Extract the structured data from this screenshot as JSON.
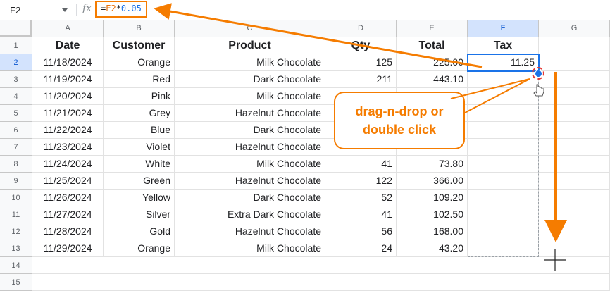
{
  "formula_bar": {
    "name_box": "F2",
    "fx_label": "fx",
    "formula": {
      "eq": "=",
      "ref": "E2",
      "op": "*",
      "num": "0.05"
    }
  },
  "columns": [
    "A",
    "B",
    "C",
    "D",
    "E",
    "F",
    "G"
  ],
  "row_numbers": [
    "1",
    "2",
    "3",
    "4",
    "5",
    "6",
    "7",
    "8",
    "9",
    "10",
    "11",
    "12",
    "13",
    "14",
    "15"
  ],
  "headers": {
    "date": "Date",
    "customer": "Customer",
    "product": "Product",
    "qty": "Qty",
    "total": "Total",
    "tax": "Tax"
  },
  "rows": [
    {
      "date": "11/18/2024",
      "customer": "Orange",
      "product": "Milk Chocolate",
      "qty": "125",
      "total": "225.00",
      "tax": "11.25"
    },
    {
      "date": "11/19/2024",
      "customer": "Red",
      "product": "Dark Chocolate",
      "qty": "211",
      "total": "443.10",
      "tax": ""
    },
    {
      "date": "11/20/2024",
      "customer": "Pink",
      "product": "Milk Chocolate",
      "qty": "",
      "total": "",
      "tax": ""
    },
    {
      "date": "11/21/2024",
      "customer": "Grey",
      "product": "Hazelnut Chocolate",
      "qty": "",
      "total": "",
      "tax": ""
    },
    {
      "date": "11/22/2024",
      "customer": "Blue",
      "product": "Dark Chocolate",
      "qty": "",
      "total": "",
      "tax": ""
    },
    {
      "date": "11/23/2024",
      "customer": "Violet",
      "product": "Hazelnut Chocolate",
      "qty": "",
      "total": "",
      "tax": ""
    },
    {
      "date": "11/24/2024",
      "customer": "White",
      "product": "Milk Chocolate",
      "qty": "41",
      "total": "73.80",
      "tax": ""
    },
    {
      "date": "11/25/2024",
      "customer": "Green",
      "product": "Hazelnut Chocolate",
      "qty": "122",
      "total": "366.00",
      "tax": ""
    },
    {
      "date": "11/26/2024",
      "customer": "Yellow",
      "product": "Dark Chocolate",
      "qty": "52",
      "total": "109.20",
      "tax": ""
    },
    {
      "date": "11/27/2024",
      "customer": "Silver",
      "product": "Extra Dark Chocolate",
      "qty": "41",
      "total": "102.50",
      "tax": ""
    },
    {
      "date": "11/28/2024",
      "customer": "Gold",
      "product": "Hazelnut Chocolate",
      "qty": "56",
      "total": "168.00",
      "tax": ""
    },
    {
      "date": "11/29/2024",
      "customer": "Orange",
      "product": "Milk Chocolate",
      "qty": "24",
      "total": "43.20",
      "tax": ""
    }
  ],
  "callout": {
    "line1": "drag-n-drop or",
    "line2": "double click"
  },
  "colors": {
    "accent": "#f57c00",
    "selection": "#1a73e8",
    "ring": "#e53935"
  }
}
